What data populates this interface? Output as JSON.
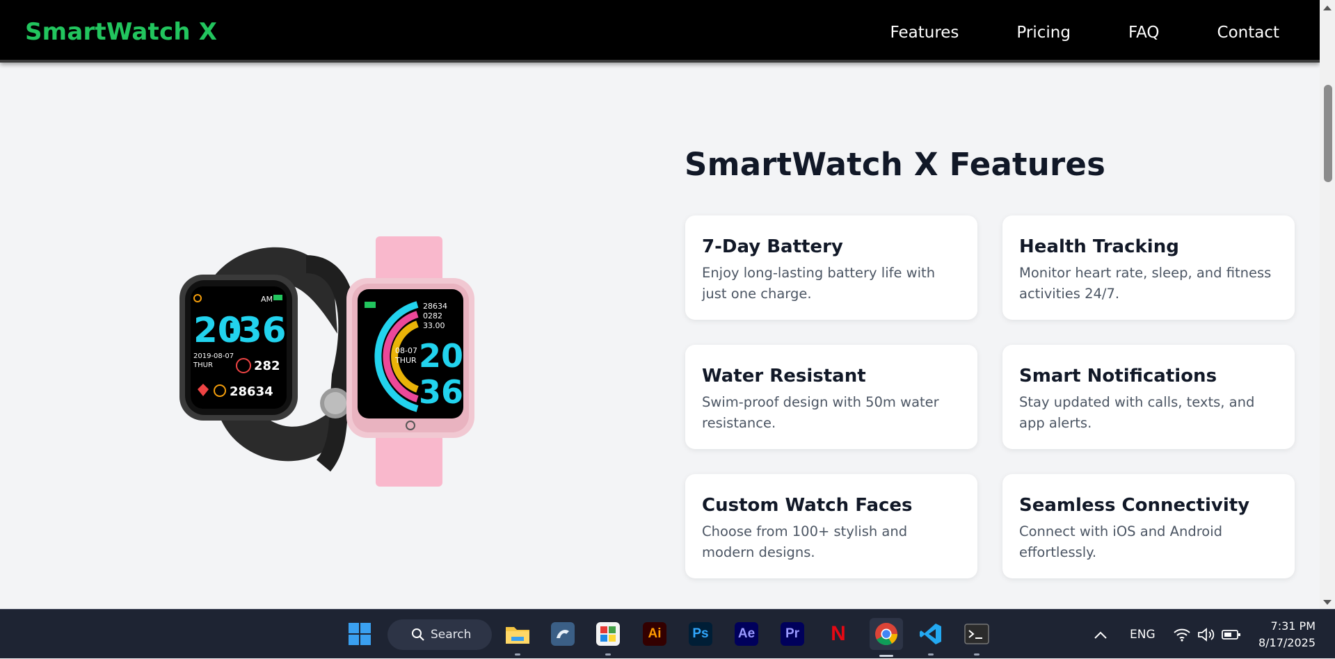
{
  "navbar": {
    "brand": "SmartWatch X",
    "links": [
      "Features",
      "Pricing",
      "FAQ",
      "Contact"
    ]
  },
  "hero_image": {
    "alt": "Two smartwatches, black and pink",
    "black_watch": {
      "time_top": "20",
      "time_bottom": "36",
      "am": "AM",
      "date": "2019-08-07",
      "day": "THUR",
      "heart": "282",
      "steps": "28634"
    },
    "pink_watch": {
      "steps": "28634",
      "heart": "0282",
      "distance": "33.00",
      "date": "08-07",
      "day": "THUR",
      "hour": "20",
      "minute": "36"
    }
  },
  "features": {
    "title": "SmartWatch X Features",
    "cards": [
      {
        "title": "7-Day Battery",
        "desc": "Enjoy long-lasting battery life with just one charge."
      },
      {
        "title": "Health Tracking",
        "desc": "Monitor heart rate, sleep, and fitness activities 24/7."
      },
      {
        "title": "Water Resistant",
        "desc": "Swim-proof design with 50m water resistance."
      },
      {
        "title": "Smart Notifications",
        "desc": "Stay updated with calls, texts, and app alerts."
      },
      {
        "title": "Custom Watch Faces",
        "desc": "Choose from 100+ stylish and modern designs."
      },
      {
        "title": "Seamless Connectivity",
        "desc": "Connect with iOS and Android effortlessly."
      }
    ]
  },
  "taskbar": {
    "search_label": "Search",
    "apps": [
      {
        "name": "file-explorer",
        "glyph": ""
      },
      {
        "name": "mysql-workbench",
        "glyph": ""
      },
      {
        "name": "app-tile",
        "glyph": ""
      },
      {
        "name": "illustrator",
        "glyph": "Ai",
        "color": "#ff9a00",
        "bg": "#330000"
      },
      {
        "name": "photoshop",
        "glyph": "Ps",
        "color": "#31a8ff",
        "bg": "#001e36"
      },
      {
        "name": "after-effects",
        "glyph": "Ae",
        "color": "#9999ff",
        "bg": "#00005b"
      },
      {
        "name": "premiere-pro",
        "glyph": "Pr",
        "color": "#9999ff",
        "bg": "#00005b"
      },
      {
        "name": "netflix",
        "glyph": "N",
        "color": "#e50914"
      },
      {
        "name": "chrome",
        "glyph": ""
      },
      {
        "name": "vscode",
        "glyph": ""
      },
      {
        "name": "terminal",
        "glyph": ""
      }
    ],
    "tray": {
      "language": "ENG",
      "time": "7:31 PM",
      "date": "8/17/2025"
    }
  },
  "colors": {
    "brand": "#22c55e",
    "nav_bg": "#000000",
    "page_bg": "#f3f4f6",
    "taskbar_bg": "#1e2433"
  }
}
